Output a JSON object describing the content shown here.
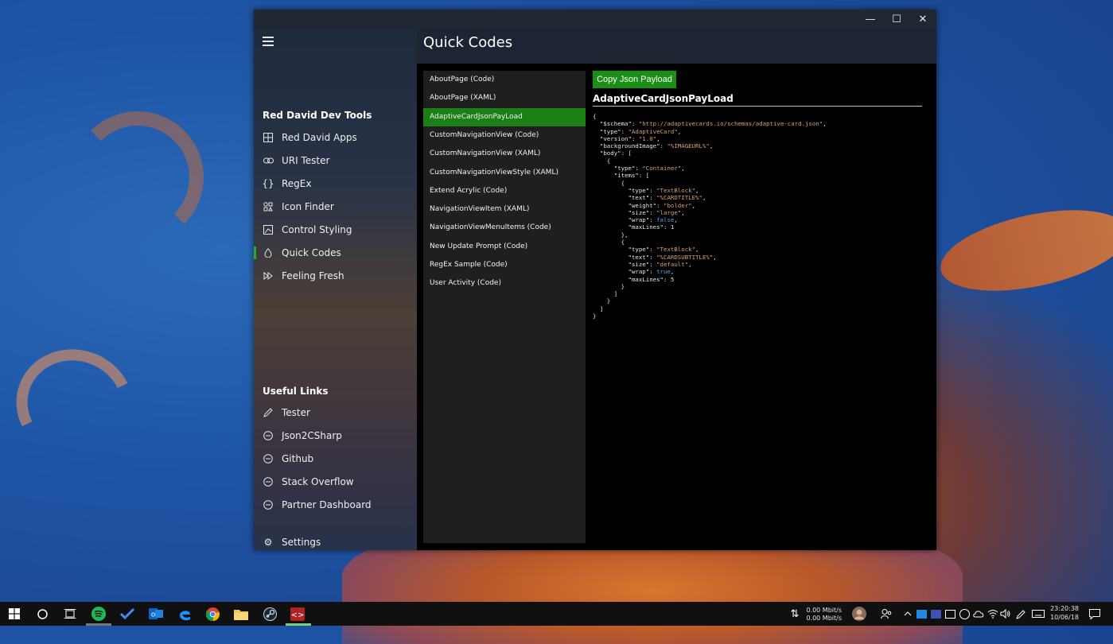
{
  "window": {
    "title": "Quick Codes",
    "controls": {
      "minimize": "—",
      "maximize": "☐",
      "close": "✕"
    }
  },
  "nav": {
    "tools_heading": "Red David Dev Tools",
    "tools": [
      {
        "label": "Red David Apps",
        "icon": "apps-icon"
      },
      {
        "label": "URI Tester",
        "icon": "link-icon"
      },
      {
        "label": "RegEx",
        "icon": "braces-icon"
      },
      {
        "label": "Icon Finder",
        "icon": "icon-grid-icon"
      },
      {
        "label": "Control Styling",
        "icon": "style-icon"
      },
      {
        "label": "Quick Codes",
        "icon": "droplet-icon",
        "active": true
      },
      {
        "label": "Feeling Fresh",
        "icon": "fast-forward-icon"
      }
    ],
    "links_heading": "Useful Links",
    "links": [
      {
        "label": "Tester",
        "icon": "pen-icon"
      },
      {
        "label": "Json2CSharp",
        "icon": "circle-minus-icon"
      },
      {
        "label": "Github",
        "icon": "circle-minus-icon"
      },
      {
        "label": "Stack Overflow",
        "icon": "circle-minus-icon"
      },
      {
        "label": "Partner Dashboard",
        "icon": "circle-minus-icon"
      }
    ],
    "settings": "Settings"
  },
  "codes": [
    "AboutPage (Code)",
    "AboutPage (XAML)",
    "AdaptiveCardJsonPayLoad",
    "CustomNavigationView (Code)",
    "CustomNavigationView (XAML)",
    "CustomNavigationViewStyle (XAML)",
    "Extend Acrylic (Code)",
    "NavigationViewItem (XAML)",
    "NavigationViewMenuItems (Code)",
    "New Update Prompt (Code)",
    "RegEx Sample (Code)",
    "User Activity (Code)"
  ],
  "selected_code": "AdaptiveCardJsonPayLoad",
  "detail": {
    "copy_button": "Copy Json Payload",
    "title": "AdaptiveCardJsonPayLoad",
    "schema": "\"http://adaptivecards.io/schemas/adaptive-card.json\"",
    "type": "\"AdaptiveCard\"",
    "version": "\"1.0\"",
    "background_image": "\"%IMAGEURL%\"",
    "container_type": "\"Container\"",
    "item1_type": "\"TextBlock\"",
    "item1_text": "\"%CARDTITLE%\"",
    "item1_weight": "\"bolder\"",
    "item1_size": "\"large\"",
    "item1_wrap": "false",
    "item1_maxlines": "1",
    "item2_type": "\"TextBlock\"",
    "item2_text": "\"%CARDSUBTITLE%\"",
    "item2_size": "\"default\"",
    "item2_wrap": "true",
    "item2_maxlines": "5"
  },
  "taskbar": {
    "net_up": "0.00 Mbit/s",
    "net_down": "0.00 Mbit/s",
    "time": "23:20:38",
    "date": "10/06/18"
  },
  "colors": {
    "accent": "#1a8f14",
    "active_indicator": "#2fa82f"
  }
}
